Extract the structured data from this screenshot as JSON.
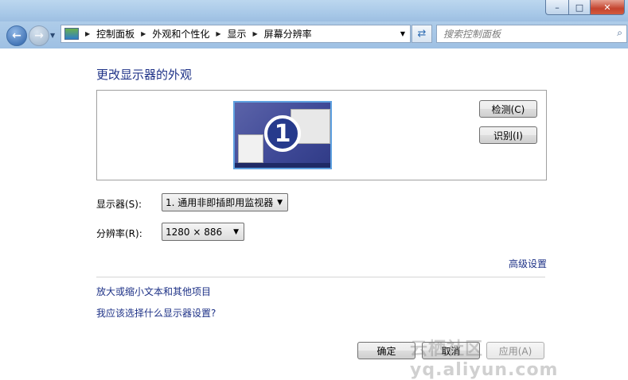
{
  "window": {
    "minimize_glyph": "–",
    "maximize_glyph": "□",
    "close_glyph": "✕"
  },
  "nav": {
    "breadcrumbs": [
      "控制面板",
      "外观和个性化",
      "显示",
      "屏幕分辨率"
    ],
    "search_placeholder": "搜索控制面板"
  },
  "main": {
    "title": "更改显示器的外观",
    "monitor_number": "1",
    "detect_label": "检测(C)",
    "identify_label": "识别(I)",
    "display_label": "显示器(S):",
    "display_value": "1. 通用非即插即用监视器",
    "resolution_label": "分辨率(R):",
    "resolution_value": "1280 × 886",
    "advanced_link": "高级设置",
    "link_text_size": "放大或缩小文本和其他项目",
    "link_which_settings": "我应该选择什么显示器设置?"
  },
  "footer": {
    "ok_label": "确定",
    "cancel_label": "取消",
    "apply_label": "应用(A)"
  },
  "watermark": "云栖社区 yq.aliyun.com"
}
